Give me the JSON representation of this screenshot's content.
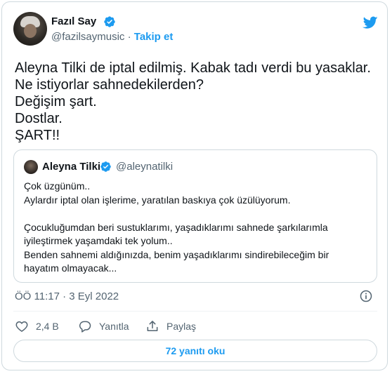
{
  "author": {
    "name": "Fazıl Say",
    "handle": "@fazilsaymusic",
    "separator": "·",
    "follow_label": "Takip et"
  },
  "tweet": {
    "lines": [
      "Aleyna Tilki de iptal edilmiş. Kabak tadı verdi bu yasaklar.",
      "Ne istiyorlar sahnedekilerden?",
      "Değişim şart.",
      "Dostlar.",
      "ŞART!!"
    ]
  },
  "quoted": {
    "name": "Aleyna Tilki",
    "handle": "@aleynatilki",
    "lines": [
      "Çok üzgünüm..",
      "Aylardır iptal olan işlerime, yaratılan baskıya çok üzülüyorum.",
      "",
      "Çocukluğumdan beri sustuklarımı, yaşadıklarımı sahnede şarkılarımla",
      "iyileştirmek yaşamdaki tek yolum..",
      "Benden sahnemi aldığınızda, benim yaşadıklarımı sindirebileceğim bir",
      "hayatım olmayacak..."
    ]
  },
  "meta": {
    "timestamp": "ÖÖ 11:17 · 3 Eyl 2022"
  },
  "actions": {
    "like_count": "2,4 B",
    "reply_label": "Yanıtla",
    "share_label": "Paylaş"
  },
  "read_replies_label": "72 yanıtı oku",
  "icons": {
    "verified": "verified-badge-icon",
    "brand": "twitter-bird-icon",
    "info": "info-icon",
    "like": "heart-icon",
    "reply": "speech-bubble-icon",
    "share": "share-arrow-icon"
  },
  "colors": {
    "accent": "#1d9bf0",
    "text": "#0f1419",
    "muted": "#536471",
    "border": "#cfd9de"
  }
}
